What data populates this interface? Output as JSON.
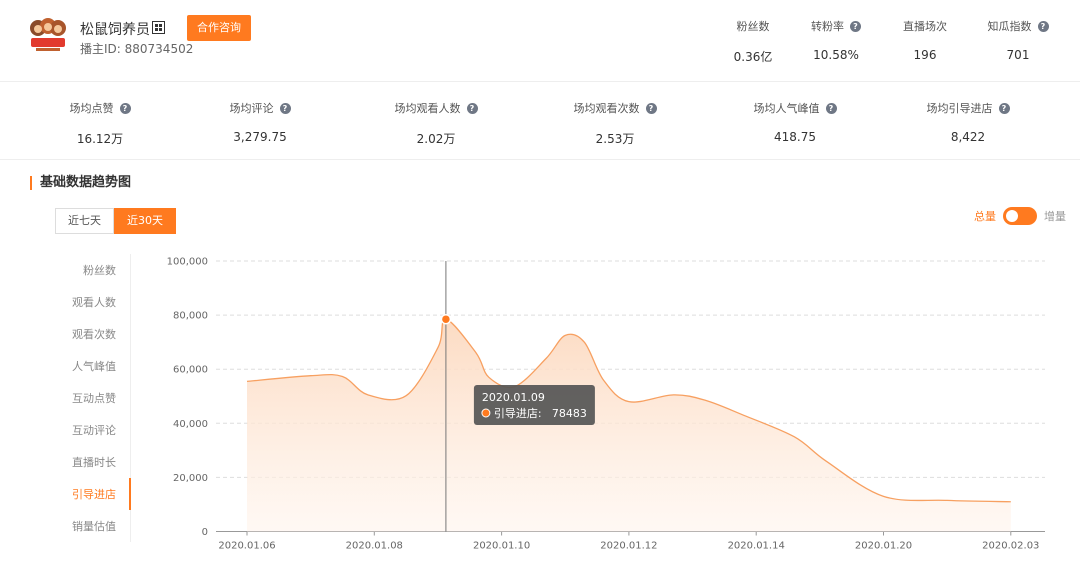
{
  "host": {
    "name": "松鼠饲养员",
    "id_label": "播主ID: 880734502",
    "cooperate_button": "合作咨询"
  },
  "top_stats": [
    {
      "label": "粉丝数",
      "value": "0.36亿",
      "help": false
    },
    {
      "label": "转粉率",
      "value": "10.58%",
      "help": true
    },
    {
      "label": "直播场次",
      "value": "196",
      "help": false
    },
    {
      "label": "知瓜指数",
      "value": "701",
      "help": true
    }
  ],
  "metrics": [
    {
      "label": "场均点赞",
      "value": "16.12万"
    },
    {
      "label": "场均评论",
      "value": "3,279.75"
    },
    {
      "label": "场均观看人数",
      "value": "2.02万"
    },
    {
      "label": "场均观看次数",
      "value": "2.53万"
    },
    {
      "label": "场均人气峰值",
      "value": "418.75"
    },
    {
      "label": "场均引导进店",
      "value": "8,422"
    }
  ],
  "section_title": "基础数据趋势图",
  "range_tabs": [
    {
      "label": "近七天",
      "active": false
    },
    {
      "label": "近30天",
      "active": true
    }
  ],
  "toggle": {
    "left": "总量",
    "right": "增量"
  },
  "side_menu": [
    {
      "label": "粉丝数",
      "active": false
    },
    {
      "label": "观看人数",
      "active": false
    },
    {
      "label": "观看次数",
      "active": false
    },
    {
      "label": "人气峰值",
      "active": false
    },
    {
      "label": "互动点赞",
      "active": false
    },
    {
      "label": "互动评论",
      "active": false
    },
    {
      "label": "直播时长",
      "active": false
    },
    {
      "label": "引导进店",
      "active": true
    },
    {
      "label": "销量估值",
      "active": false
    }
  ],
  "colors": {
    "accent": "#ff7a1f",
    "area_fill": "#fde3cf"
  },
  "chart_data": {
    "type": "area",
    "series": [
      {
        "name": "引导进店",
        "color": "#ff7a1f"
      }
    ],
    "x_ticks": [
      "2020.01.06",
      "2020.01.08",
      "2020.01.10",
      "2020.01.12",
      "2020.01.14",
      "2020.01.20",
      "2020.02.03"
    ],
    "points": [
      {
        "pos": 0.0,
        "value": 55500
      },
      {
        "pos": 0.5,
        "value": 57600
      },
      {
        "pos": 0.75,
        "value": 57300
      },
      {
        "pos": 0.95,
        "value": 50500
      },
      {
        "pos": 1.25,
        "value": 50200
      },
      {
        "pos": 1.5,
        "value": 68000
      },
      {
        "pos": 1.5625,
        "value": 78483
      },
      {
        "pos": 1.8,
        "value": 66000
      },
      {
        "pos": 1.9,
        "value": 57000
      },
      {
        "pos": 2.1,
        "value": 53500
      },
      {
        "pos": 2.35,
        "value": 64000
      },
      {
        "pos": 2.5,
        "value": 72500
      },
      {
        "pos": 2.65,
        "value": 70000
      },
      {
        "pos": 2.8,
        "value": 56000
      },
      {
        "pos": 3.0,
        "value": 48000
      },
      {
        "pos": 3.35,
        "value": 50500
      },
      {
        "pos": 3.6,
        "value": 48500
      },
      {
        "pos": 3.9,
        "value": 43000
      },
      {
        "pos": 4.3,
        "value": 35000
      },
      {
        "pos": 4.55,
        "value": 26000
      },
      {
        "pos": 5.0,
        "value": 13000
      },
      {
        "pos": 5.5,
        "value": 11500
      },
      {
        "pos": 6.0,
        "value": 11000
      }
    ],
    "yticks": [
      "0",
      "20,000",
      "40,000",
      "60,000",
      "80,000",
      "100,000"
    ],
    "ylim": [
      0,
      100000
    ],
    "grid": true,
    "tooltip": {
      "date": "2020.01.09",
      "label": "引导进店:",
      "value": "78483",
      "pos": 1.5625,
      "point_value": 78483
    }
  }
}
